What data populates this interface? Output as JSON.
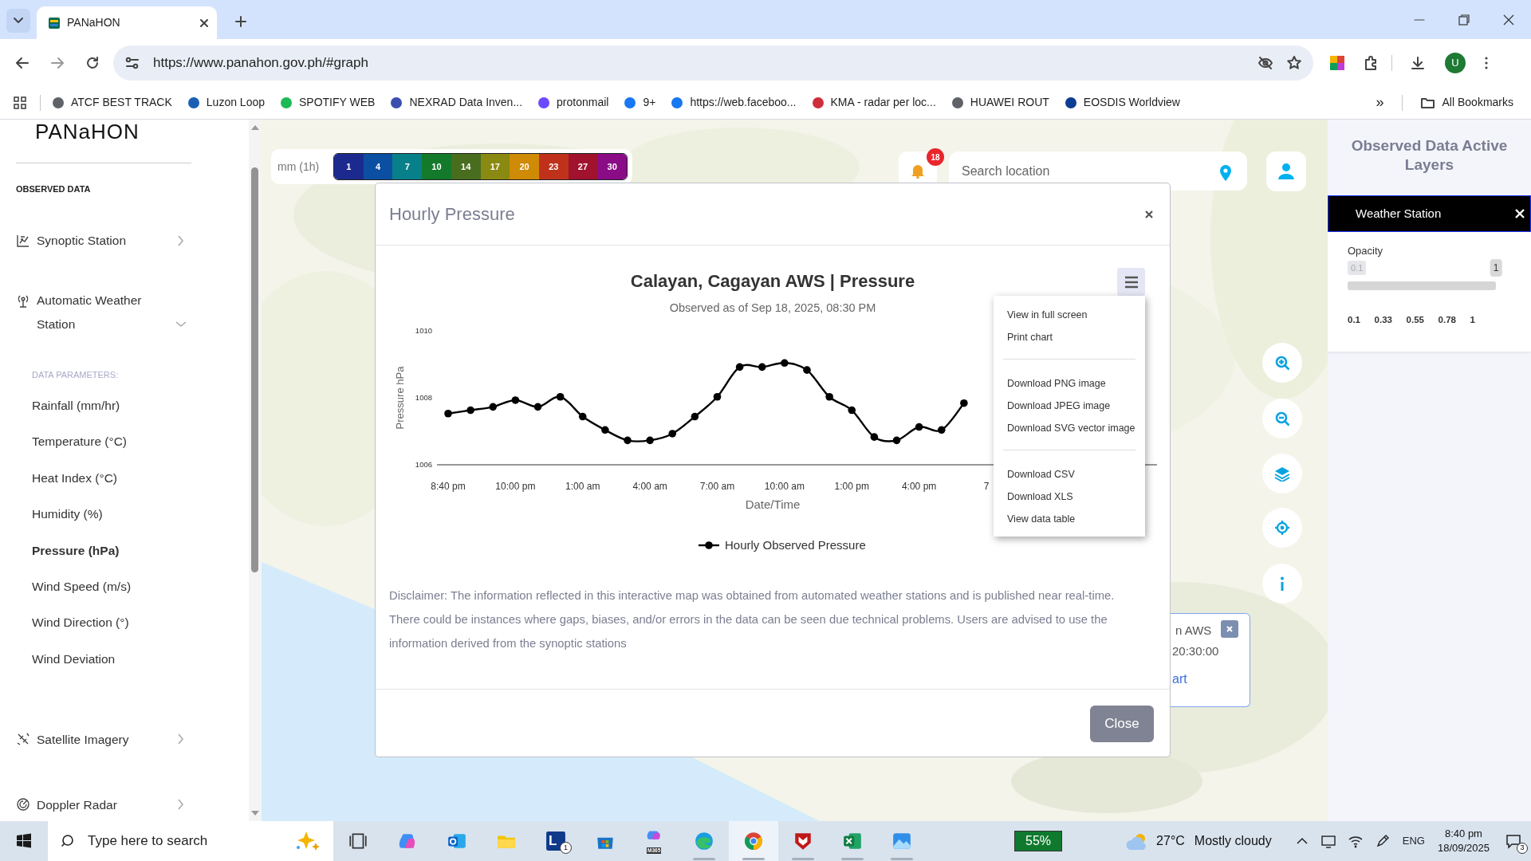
{
  "browser": {
    "tab": {
      "title": "PANaHON",
      "selected": true
    },
    "url": "https://www.panahon.gov.ph/#graph",
    "profile_initial": "U",
    "bookmarks": [
      {
        "label": "ATCF BEST TRACK",
        "color": "#5f6368"
      },
      {
        "label": "Luzon Loop",
        "color": "#1a5fb4"
      },
      {
        "label": "SPOTIFY WEB",
        "color": "#1db954"
      },
      {
        "label": "NEXRAD Data Inven...",
        "color": "#3a4fb0"
      },
      {
        "label": "protonmail",
        "color": "#6d4aff"
      },
      {
        "label": "9+",
        "color": "#1877f2"
      },
      {
        "label": "https://web.faceboo...",
        "color": "#1877f2"
      },
      {
        "label": "KMA - radar per loc...",
        "color": "#cd2e3a"
      },
      {
        "label": "HUAWEI ROUT",
        "color": "#5f6368"
      },
      {
        "label": "EOSDIS Worldview",
        "color": "#0b3d91"
      }
    ],
    "overflow": "»",
    "all_bookmarks": "All Bookmarks"
  },
  "sidebar": {
    "logo": "PANaHON",
    "heading": "OBSERVED DATA",
    "sections": [
      {
        "kind": "chart",
        "label": "Synoptic Station",
        "expanded": false
      },
      {
        "kind": "antenna",
        "label": "Automatic Weather Station",
        "expanded": true,
        "subheading": "DATA PARAMETERS:",
        "children": [
          {
            "label": "Rainfall (mm/hr)",
            "selected": false
          },
          {
            "label": "Temperature (°C)",
            "selected": false
          },
          {
            "label": "Heat Index (°C)",
            "selected": false
          },
          {
            "label": "Humidity (%)",
            "selected": false
          },
          {
            "label": "Pressure (hPa)",
            "selected": true
          },
          {
            "label": "Wind Speed (m/s)",
            "selected": false
          },
          {
            "label": "Wind Direction (°)",
            "selected": false
          },
          {
            "label": "Wind Deviation",
            "selected": false
          }
        ]
      },
      {
        "kind": "satellite",
        "label": "Satellite Imagery",
        "expanded": false
      },
      {
        "kind": "radar",
        "label": "Doppler Radar",
        "expanded": false
      }
    ]
  },
  "legend": {
    "unit": "mm (1h)",
    "steps": [
      {
        "label": "1",
        "color": "#1c2a8f"
      },
      {
        "label": "4",
        "color": "#0b4fa3"
      },
      {
        "label": "7",
        "color": "#08808a"
      },
      {
        "label": "10",
        "color": "#137a2c"
      },
      {
        "label": "14",
        "color": "#486d1e"
      },
      {
        "label": "17",
        "color": "#8a8a12"
      },
      {
        "label": "20",
        "color": "#cf8a06"
      },
      {
        "label": "23",
        "color": "#c0311c"
      },
      {
        "label": "27",
        "color": "#a0122e"
      },
      {
        "label": "30",
        "color": "#8a0c86"
      }
    ]
  },
  "map": {
    "notifications": "18",
    "search": {
      "placeholder": "Search location"
    },
    "popup": {
      "lines": [
        "n AWS",
        "20:30:00"
      ],
      "link": "art"
    }
  },
  "modal": {
    "title": "Hourly Pressure",
    "subtitle": "Observed as of Sep 18, 2025, 08:30 PM",
    "chart_data": {
      "type": "line",
      "title": "Calayan, Cagayan AWS | Pressure",
      "xlabel": "Date/Time",
      "ylabel": "Pressure hPa",
      "categories": [
        "8:40 pm",
        null,
        null,
        "10:00 pm",
        null,
        null,
        "1:00 am",
        null,
        null,
        "4:00 am",
        null,
        null,
        "7:00 am",
        null,
        null,
        "10:00 am",
        null,
        null,
        "1:00 pm",
        null,
        null,
        "4:00 pm",
        null,
        null,
        "7"
      ],
      "series": [
        {
          "name": "Hourly Observed Pressure",
          "color": "#000000",
          "marker": true,
          "values": [
            1007.53,
            1007.63,
            1007.73,
            1007.93,
            1007.73,
            1008.03,
            1007.44,
            1007.04,
            1006.73,
            1006.73,
            1006.93,
            1007.44,
            1008.03,
            1008.92,
            1008.92,
            1009.04,
            1008.83,
            1008.03,
            1007.63,
            1006.83,
            1006.73,
            1007.13,
            1007.04,
            1007.84,
            null
          ]
        }
      ],
      "ylim": [
        1006,
        1010
      ],
      "yticks": [
        1006,
        1008,
        1010
      ]
    },
    "menu": {
      "expanded": true,
      "items": [
        {
          "kind": "item",
          "label": "View in full screen"
        },
        {
          "kind": "item",
          "label": "Print chart"
        },
        {
          "kind": "divider"
        },
        {
          "kind": "item",
          "label": "Download PNG image"
        },
        {
          "kind": "item",
          "label": "Download JPEG image"
        },
        {
          "kind": "item",
          "label": "Download SVG vector image"
        },
        {
          "kind": "divider"
        },
        {
          "kind": "item",
          "label": "Download CSV"
        },
        {
          "kind": "item",
          "label": "Download XLS"
        },
        {
          "kind": "item",
          "label": "View data table"
        }
      ]
    },
    "disclaimer": "Disclaimer: The information reflected in this interactive map was obtained from automated weather stations and is published near real-time. There could be instances where gaps, biases, and/or errors in the data can be seen due technical problems. Users are advised to use the information derived from the synoptic stations",
    "close_button": "Close"
  },
  "right_panel": {
    "title": "Observed Data Active Layers",
    "layer": {
      "title": "Weather Station",
      "opacity_label": "Opacity",
      "min_label": "0.1",
      "value_label": "1",
      "level": 1,
      "ticks": [
        "0.1",
        "0.33",
        "0.55",
        "0.78",
        "1"
      ]
    }
  },
  "taskbar": {
    "search_placeholder": "Type here to search",
    "apps": [
      {
        "kind": "taskview",
        "running": false,
        "active": false
      },
      {
        "kind": "copilot",
        "running": false,
        "active": false
      },
      {
        "kind": "outlook",
        "running": false,
        "active": false
      },
      {
        "kind": "explorer",
        "running": false,
        "active": false
      },
      {
        "kind": "lapp",
        "label": "L",
        "badge": "1",
        "running": false,
        "active": false
      },
      {
        "kind": "store",
        "running": false,
        "active": false
      },
      {
        "kind": "m365",
        "label": "M365",
        "running": false,
        "active": false
      },
      {
        "kind": "edge",
        "running": true,
        "active": false
      },
      {
        "kind": "chrome",
        "running": true,
        "active": true
      },
      {
        "kind": "mcafee",
        "running": true,
        "active": false
      },
      {
        "kind": "excel",
        "running": true,
        "active": false
      },
      {
        "kind": "photos",
        "running": true,
        "active": false
      }
    ],
    "battery": "55%",
    "temperature": "27°C",
    "condition": "Mostly cloudy",
    "language": "ENG",
    "time": "8:40 pm",
    "date": "18/09/2025",
    "notifications": "3"
  }
}
